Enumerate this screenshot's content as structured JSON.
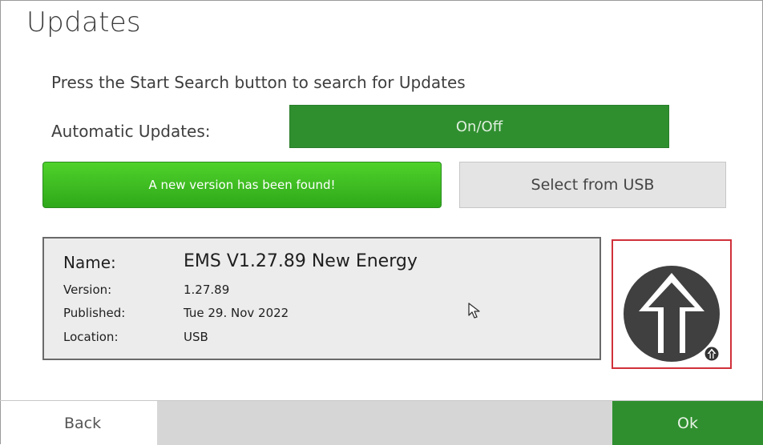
{
  "page": {
    "title": "Updates"
  },
  "instruction": "Press the Start Search button to search for Updates",
  "automatic_updates": {
    "label": "Automatic Updates:",
    "toggle_label": "On/Off"
  },
  "actions": {
    "status_button": "A new version has been found!",
    "usb_button": "Select from USB"
  },
  "update_info": {
    "name_label": "Name:",
    "name_value": "EMS V1.27.89 New Energy",
    "version_label": "Version:",
    "version_value": "1.27.89",
    "published_label": "Published:",
    "published_value": "Tue 29. Nov 2022",
    "location_label": "Location:",
    "location_value": "USB"
  },
  "footer": {
    "back_label": "Back",
    "ok_label": "Ok"
  },
  "colors": {
    "accent_green": "#2f8f2f",
    "found_green": "#3cbf22",
    "highlight_red": "#d0303a",
    "icon_dark": "#404040"
  },
  "icons": {
    "upload": "upload-arrow-icon",
    "cursor": "mouse-pointer-icon"
  }
}
